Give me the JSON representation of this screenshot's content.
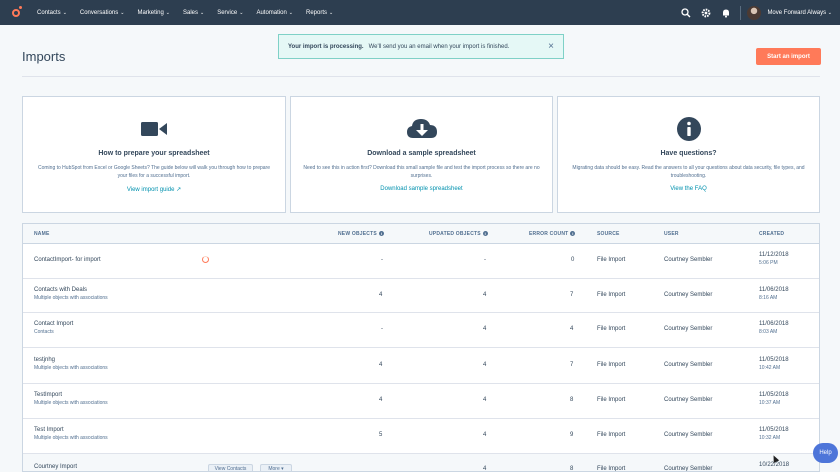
{
  "nav": {
    "items": [
      {
        "label": "Contacts"
      },
      {
        "label": "Conversations"
      },
      {
        "label": "Marketing"
      },
      {
        "label": "Sales"
      },
      {
        "label": "Service"
      },
      {
        "label": "Automation"
      },
      {
        "label": "Reports"
      }
    ],
    "account_name": "Move Forward Always",
    "icons": [
      "hubspot-logo",
      "search-icon",
      "gear-icon",
      "bell-icon"
    ]
  },
  "page": {
    "title": "Imports",
    "start_button": "Start an import"
  },
  "alert": {
    "strong": "Your import is processing.",
    "text": "We'll send you an email when your import is finished.",
    "close": "×"
  },
  "cards": [
    {
      "icon": "video-camera-icon",
      "title": "How to prepare your spreadsheet",
      "description": "Coming to HubSpot from Excel or Google Sheets? The guide below will walk you through how to prepare your files for a successful import.",
      "link": "View import guide"
    },
    {
      "icon": "cloud-download-icon",
      "title": "Download a sample spreadsheet",
      "description": "Need to see this in action first? Download this small sample file and test the import process so there are no surprises.",
      "link": "Download sample spreadsheet"
    },
    {
      "icon": "info-icon",
      "title": "Have questions?",
      "description": "Migrating data should be easy. Read the answers to all your questions about data security, file types, and troubleshooting.",
      "link": "View the FAQ"
    }
  ],
  "table": {
    "columns": {
      "name": "NAME",
      "new_objects": "NEW OBJECTS",
      "updated_objects": "UPDATED OBJECTS",
      "error_count": "ERROR COUNT",
      "source": "SOURCE",
      "user": "USER",
      "created": "CREATED"
    },
    "rows": [
      {
        "name": "ContactImport- for import",
        "sub": "",
        "new_objects": "-",
        "updated_objects": "-",
        "error_count": "0",
        "source": "File Import",
        "user": "Courtney Sembler",
        "date": "11/12/2018",
        "time": "5:06 PM"
      },
      {
        "name": "Contacts with Deals",
        "sub": "Multiple objects with associations",
        "new_objects": "4",
        "updated_objects": "4",
        "error_count": "7",
        "source": "File Import",
        "user": "Courtney Sembler",
        "date": "11/06/2018",
        "time": "8:16 AM"
      },
      {
        "name": "Contact Import",
        "sub": "Contacts",
        "new_objects": "-",
        "updated_objects": "4",
        "error_count": "4",
        "source": "File Import",
        "user": "Courtney Sembler",
        "date": "11/06/2018",
        "time": "8:03 AM"
      },
      {
        "name": "testjnhg",
        "sub": "Multiple objects with associations",
        "new_objects": "4",
        "updated_objects": "4",
        "error_count": "7",
        "source": "File Import",
        "user": "Courtney Sembler",
        "date": "11/05/2018",
        "time": "10:42 AM"
      },
      {
        "name": "TestImport",
        "sub": "Multiple objects with associations",
        "new_objects": "4",
        "updated_objects": "4",
        "error_count": "8",
        "source": "File Import",
        "user": "Courtney Sembler",
        "date": "11/05/2018",
        "time": "10:37 AM"
      },
      {
        "name": "Test Import",
        "sub": "Multiple objects with associations",
        "new_objects": "5",
        "updated_objects": "4",
        "error_count": "9",
        "source": "File Import",
        "user": "Courtney Sembler",
        "date": "11/05/2018",
        "time": "10:32 AM"
      },
      {
        "name": "Courtney Import",
        "sub": "",
        "new_objects": "",
        "updated_objects": "4",
        "error_count": "8",
        "source": "File Import",
        "user": "Courtney Sembler",
        "date": "10/22/2018",
        "time": ""
      }
    ],
    "row_actions": {
      "view": "View Contacts",
      "more": "More ▾"
    }
  },
  "help": {
    "label": "Help"
  }
}
